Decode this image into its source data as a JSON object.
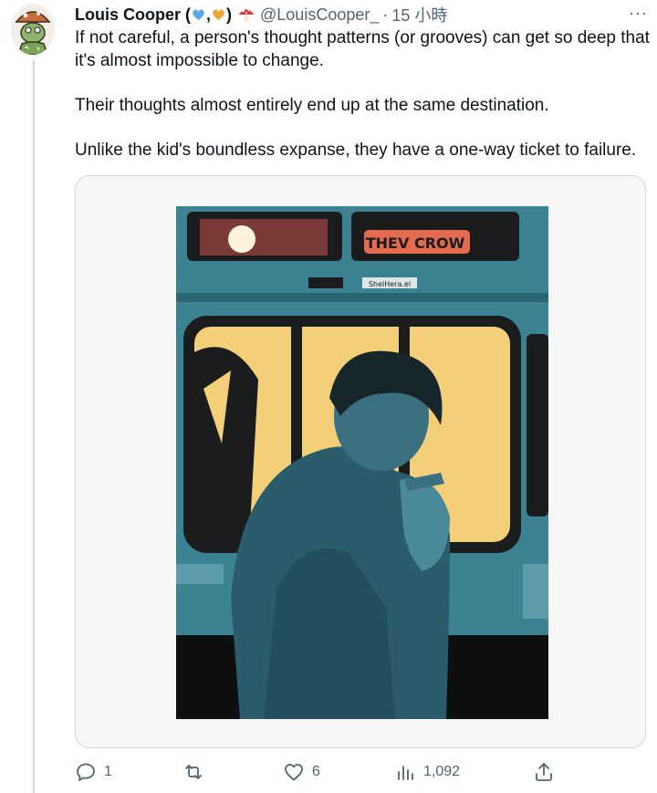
{
  "tweet": {
    "author_name": "Louis Cooper (",
    "comma": ",",
    "close_paren": ")",
    "handle": "@LouisCooper_",
    "separator": "·",
    "time": "15 小時",
    "more_label": "···",
    "paragraphs": [
      "If not careful, a person's thought patterns (or grooves) can get so deep that it's almost impossible to change.",
      "Their thoughts almost entirely end up at the same destination.",
      "Unlike the kid's boundless expanse, they have a one-way ticket to failure."
    ],
    "image_sign_text": "THEV CROW",
    "image_label_text": "ShelHera.el"
  },
  "actions": {
    "reply_count": "1",
    "retweet_count": "",
    "like_count": "6",
    "view_count": "1,092"
  },
  "colors": {
    "heart_blue": "#5aa9e6",
    "heart_orange": "#f4a23a",
    "mushroom_red": "#d83b47",
    "bus_teal": "#3b8293",
    "window_yellow": "#f3cf79",
    "sign_red": "#e46a50"
  }
}
